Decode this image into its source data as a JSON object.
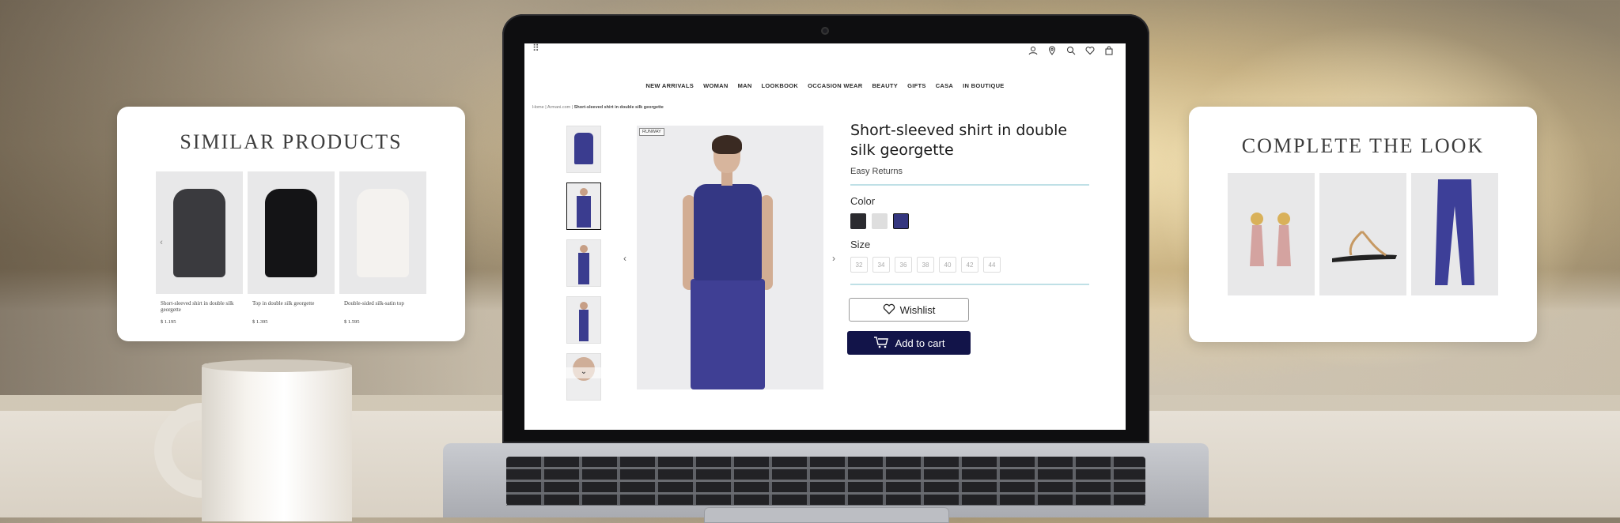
{
  "site": {
    "nav": [
      "NEW ARRIVALS",
      "WOMAN",
      "MAN",
      "LOOKBOOK",
      "OCCASION WEAR",
      "BEAUTY",
      "GIFTS",
      "CASA",
      "IN BOUTIQUE"
    ],
    "top_icons": [
      "user-icon",
      "location-icon",
      "search-icon",
      "wishlist-icon",
      "bag-icon"
    ],
    "breadcrumb": {
      "home": "Home",
      "sep1": "|",
      "brand": "Armani.com",
      "sep2": "|",
      "current": "Short-sleeved shirt in double silk georgette"
    }
  },
  "product": {
    "badge": "RUNWAY",
    "title": "Short-sleeved shirt in double silk georgette",
    "returns": "Easy Returns",
    "color_label": "Color",
    "colors": [
      "#2b2b30",
      "#dedede",
      "#34367f"
    ],
    "size_label": "Size",
    "sizes": [
      "32",
      "34",
      "36",
      "38",
      "40",
      "42",
      "44"
    ],
    "wishlist_label": "Wishlist",
    "cart_label": "Add to cart",
    "prev_arrow": "‹",
    "next_arrow": "›",
    "thumbs_down": "⌄"
  },
  "similar": {
    "title": "SIMILAR PRODUCTS",
    "items": [
      {
        "name": "Short-sleeved shirt in double silk georgette",
        "price": "$ 1.195",
        "color": "#3a3a3e"
      },
      {
        "name": "Top in double silk georgette",
        "price": "$ 1.395",
        "color": "#141416"
      },
      {
        "name": "Double-sided silk-satin top",
        "price": "$ 1.595",
        "color": "#f4f2ef"
      }
    ],
    "arrow": "‹"
  },
  "look": {
    "title": "COMPLETE THE LOOK",
    "items": [
      "earrings",
      "sandals",
      "trousers"
    ]
  }
}
